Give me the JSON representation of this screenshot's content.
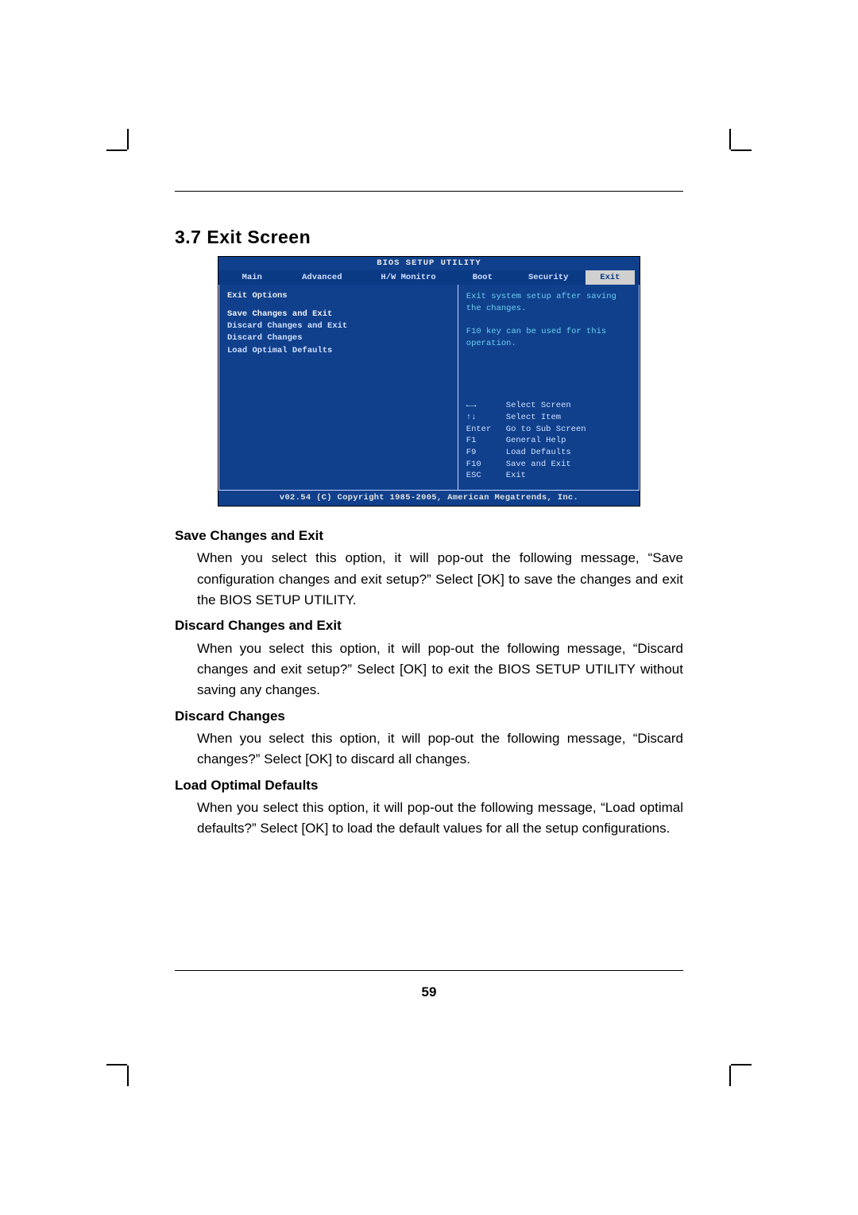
{
  "section_heading": "3.7  Exit Screen",
  "bios": {
    "title": "BIOS SETUP UTILITY",
    "tabs": [
      "Main",
      "Advanced",
      "H/W Monitro",
      "Boot",
      "Security",
      "Exit"
    ],
    "active_tab_index": 5,
    "left": {
      "group": "Exit Options",
      "options": [
        "Save Changes and Exit",
        "Discard Changes and Exit",
        "Discard Changes",
        "",
        "Load Optimal Defaults"
      ],
      "selected_index": 0
    },
    "right": {
      "help": "Exit system setup after saving the changes.\n\nF10 key can be used for this operation.",
      "keys": [
        {
          "k": "←→",
          "d": "Select Screen"
        },
        {
          "k": "↑↓",
          "d": "Select Item"
        },
        {
          "k": "Enter",
          "d": "Go to Sub Screen"
        },
        {
          "k": "F1",
          "d": "General Help"
        },
        {
          "k": "F9",
          "d": "Load Defaults"
        },
        {
          "k": "F10",
          "d": "Save and Exit"
        },
        {
          "k": "ESC",
          "d": "Exit"
        }
      ]
    },
    "footer": "v02.54 (C) Copyright 1985-2005, American Megatrends, Inc."
  },
  "body": {
    "items": [
      {
        "h": "Save Changes and Exit",
        "p": "When you select this option, it will pop-out the following message, “Save configuration changes and exit setup?” Select [OK] to save the changes and exit the BIOS SETUP UTILITY."
      },
      {
        "h": "Discard Changes and Exit",
        "p": "When you select this option, it will pop-out the following message, “Discard changes and exit setup?” Select [OK] to exit the BIOS SETUP UTILITY without saving any changes."
      },
      {
        "h": "Discard Changes",
        "p": "When you select this option, it will pop-out the following message, “Discard changes?” Select [OK] to discard all changes."
      },
      {
        "h": "Load Optimal Defaults",
        "p": "When you select this option, it will pop-out the following message, “Load optimal defaults?” Select [OK] to load the default values for all the setup configurations."
      }
    ]
  },
  "page_number": "59"
}
